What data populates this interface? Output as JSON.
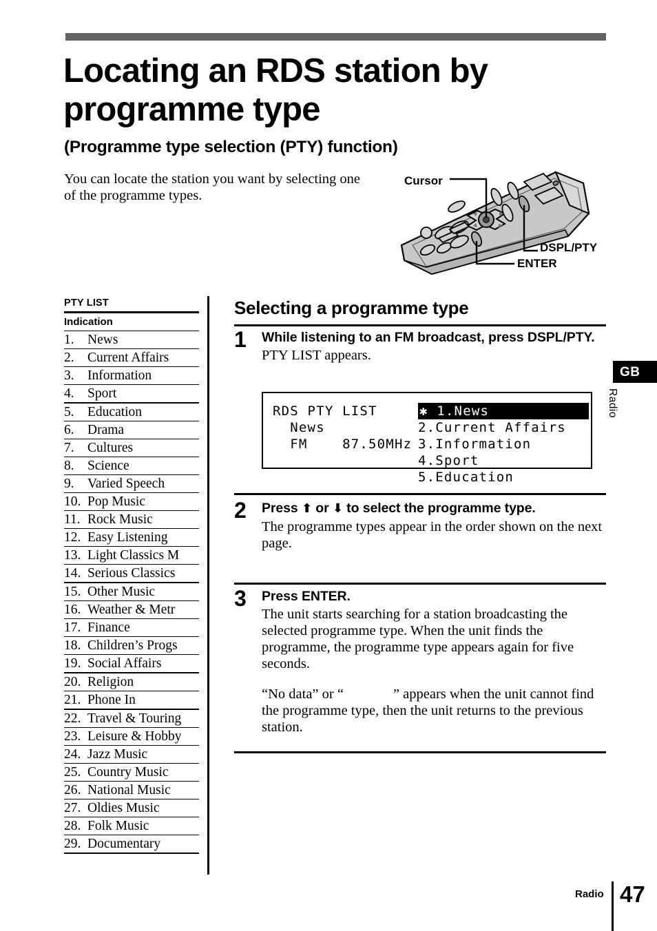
{
  "header": {
    "title": "Locating an RDS station by programme type",
    "subtitle": "(Programme type selection (PTY) function)",
    "intro": "You can locate the station you want by selecting one of the programme types."
  },
  "remote": {
    "callouts": [
      {
        "name": "cursor",
        "label": "Cursor"
      },
      {
        "name": "dspl-pty",
        "label": "DSPL/PTY"
      },
      {
        "name": "enter",
        "label": "ENTER"
      }
    ]
  },
  "pty_list": {
    "title": "PTY LIST",
    "column_header": "Indication",
    "items": [
      {
        "num": "1.",
        "label": "News"
      },
      {
        "num": "2.",
        "label": "Current Affairs"
      },
      {
        "num": "3.",
        "label": "Information"
      },
      {
        "num": "4.",
        "label": "Sport"
      },
      {
        "num": "5.",
        "label": "Education"
      },
      {
        "num": "6.",
        "label": "Drama"
      },
      {
        "num": "7.",
        "label": "Cultures"
      },
      {
        "num": "8.",
        "label": "Science"
      },
      {
        "num": "9.",
        "label": "Varied Speech"
      },
      {
        "num": "10.",
        "label": "Pop Music"
      },
      {
        "num": "11.",
        "label": "Rock Music"
      },
      {
        "num": "12.",
        "label": "Easy Listening"
      },
      {
        "num": "13.",
        "label": "Light Classics M"
      },
      {
        "num": "14.",
        "label": "Serious Classics"
      },
      {
        "num": "15.",
        "label": "Other Music"
      },
      {
        "num": "16.",
        "label": "Weather & Metr"
      },
      {
        "num": "17.",
        "label": "Finance"
      },
      {
        "num": "18.",
        "label": "Children’s Progs"
      },
      {
        "num": "19.",
        "label": "Social Affairs"
      },
      {
        "num": "20.",
        "label": "Religion"
      },
      {
        "num": "21.",
        "label": "Phone In"
      },
      {
        "num": "22.",
        "label": "Travel & Touring"
      },
      {
        "num": "23.",
        "label": "Leisure & Hobby"
      },
      {
        "num": "24.",
        "label": "Jazz Music"
      },
      {
        "num": "25.",
        "label": "Country Music"
      },
      {
        "num": "26.",
        "label": "National Music"
      },
      {
        "num": "27.",
        "label": "Oldies Music"
      },
      {
        "num": "28.",
        "label": "Folk Music"
      },
      {
        "num": "29.",
        "label": "Documentary"
      }
    ]
  },
  "procedure": {
    "heading": "Selecting a programme type",
    "steps": [
      {
        "num": "1",
        "lead": "While listening to an FM broadcast, press DSPL/PTY.",
        "text": "PTY LIST appears."
      },
      {
        "num": "2",
        "lead_prefix": "Press ",
        "arrow_up": "⬆",
        "lead_mid": " or ",
        "arrow_down": "⬇",
        "lead_suffix": " to select the programme type.",
        "text": "The programme types appear in the order shown on the next page."
      },
      {
        "num": "3",
        "lead": "Press ENTER.",
        "text": "The unit starts searching for a station broadcasting the selected programme type.  When the unit finds the programme, the programme type appears again for five seconds.",
        "text2_before": "“No data” or “",
        "text2_after": "” appears when the unit cannot find the programme type, then the unit returns to the previous station."
      }
    ]
  },
  "lcd": {
    "line1": "RDS PTY LIST",
    "line2": "  News",
    "line3": "  FM    87.50MHz",
    "selected_marker": "✱",
    "selected_item": "1.News",
    "items": [
      "2.Current Affairs",
      "3.Information",
      "4.Sport",
      "5.Education"
    ]
  },
  "sidebar": {
    "locale_tab": "GB",
    "section_vertical": "Radio"
  },
  "footer": {
    "section": "Radio",
    "page_number": "47"
  },
  "colors": {
    "top_bar": "#646464",
    "ink": "#000000",
    "paper": "#ffffff",
    "remote_body": "#c8c8c8"
  }
}
